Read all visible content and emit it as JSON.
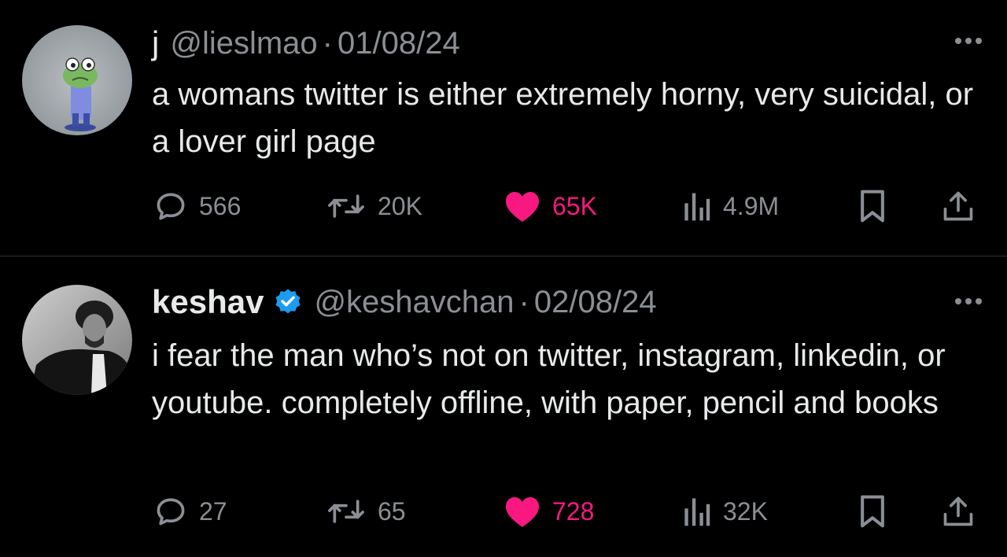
{
  "tweets": [
    {
      "display_name": "j",
      "handle": "@lieslmao",
      "separator": "·",
      "date": "01/08/24",
      "verified": false,
      "text": "a womans twitter is either extremely horny, very suicidal, or a lover girl page",
      "stats": {
        "replies": "566",
        "reposts": "20K",
        "likes": "65K",
        "views": "4.9M"
      },
      "liked": true,
      "avatar": "frog-character-avatar"
    },
    {
      "display_name": "keshav",
      "handle": "@keshavchan",
      "separator": "·",
      "date": "02/08/24",
      "verified": true,
      "text": "i fear the man who’s not on twitter, instagram, linkedin, or youtube. completely offline, with paper, pencil and books",
      "stats": {
        "replies": "27",
        "reposts": "65",
        "likes": "728",
        "views": "32K"
      },
      "liked": true,
      "avatar": "man-photo-avatar"
    }
  ],
  "icons": {
    "reply": "speech-bubble-icon",
    "repost": "repost-arrows-icon",
    "like": "heart-icon",
    "views": "bar-chart-icon",
    "bookmark": "bookmark-icon",
    "share": "share-upload-icon",
    "more": "more-dots-icon",
    "verified": "verified-badge-icon"
  },
  "colors": {
    "background": "#000000",
    "text_primary": "#e7e9ea",
    "text_secondary": "#8b8f94",
    "like": "#f91880",
    "verified": "#1d9bf0",
    "divider": "#2f3336"
  }
}
